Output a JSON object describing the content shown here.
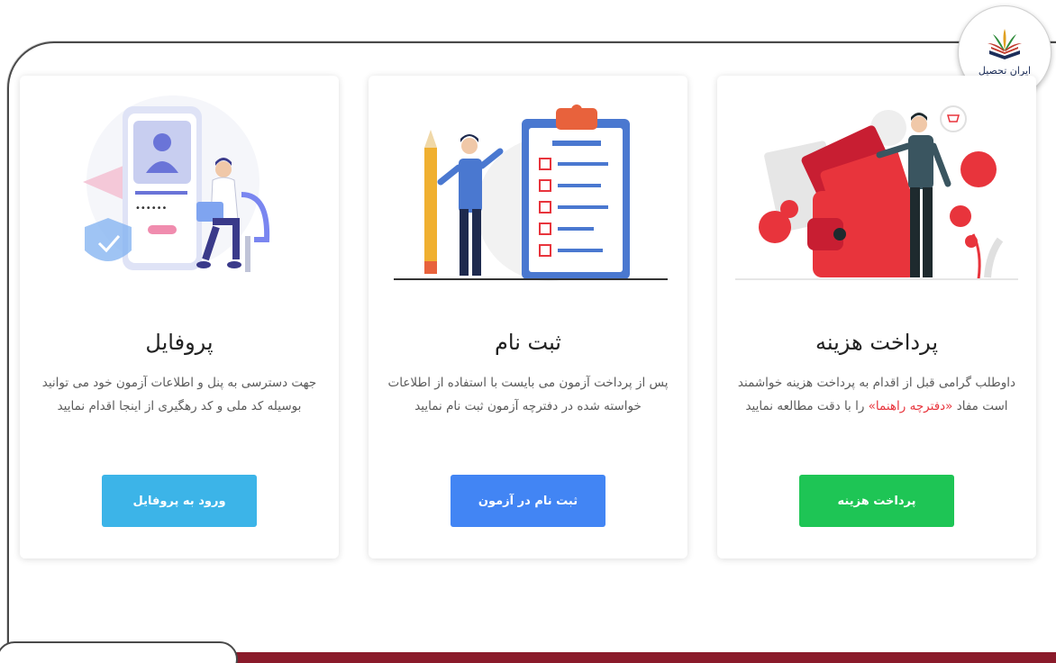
{
  "brand": {
    "name": "ایران تحصیل"
  },
  "cards": [
    {
      "id": "payment",
      "title": "پرداخت هزینه",
      "desc_before": "داوطلب گرامی قبل از اقدام به پرداخت هزینه خواشمند است مفاد ",
      "desc_highlight": "«دفترچه راهنما»",
      "desc_after": " را با دقت مطالعه نمایید",
      "button": "پرداخت هزینه",
      "button_color": "#1ec555",
      "illustration": "wallet-payment-illustration"
    },
    {
      "id": "register",
      "title": "ثبت نام",
      "desc": "پس از پرداخت آزمون می بایست با استفاده از اطلاعات خواسته شده در دفترچه آزمون ثبت نام نمایید",
      "button": "ثبت نام در آزمون",
      "button_color": "#4285f4",
      "illustration": "clipboard-checklist-illustration"
    },
    {
      "id": "profile",
      "title": "پروفایل",
      "desc": "جهت دسترسی به پنل و اطلاعات آزمون خود می توانید بوسیله کد ملی و کد رهگیری از اینجا اقدام نمایید",
      "button": "ورود به پروفایل",
      "button_color": "#3cb4e8",
      "illustration": "profile-login-illustration"
    }
  ],
  "colors": {
    "frame_border": "#4a4a4a",
    "bottom_bar": "#8a1a2a",
    "highlight": "#e8343c"
  }
}
